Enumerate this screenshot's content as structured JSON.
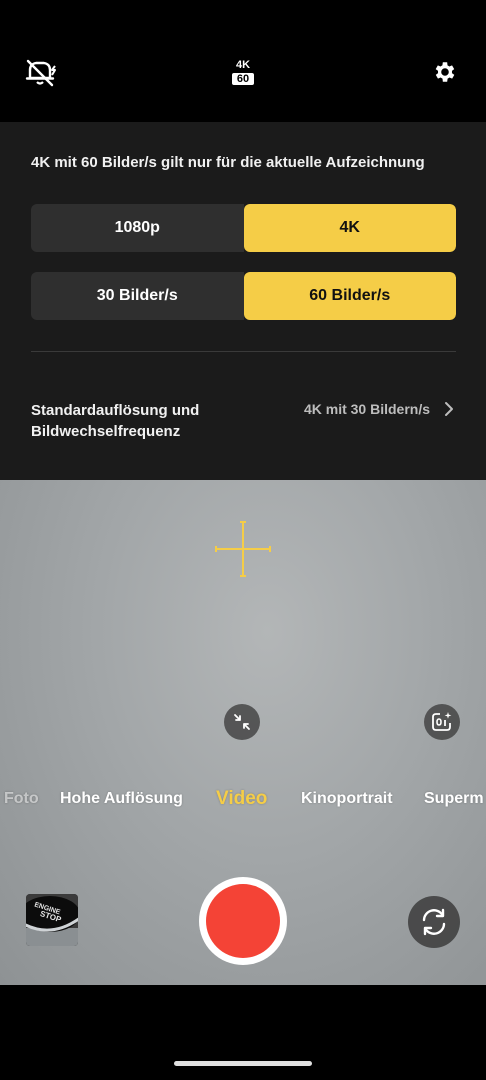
{
  "top_bar": {
    "flash_icon": "flash-off-icon",
    "resolution_badge": {
      "top": "4K",
      "bottom": "60"
    },
    "settings_icon": "gear-icon"
  },
  "panel": {
    "note": "4K mit 60 Bilder/s gilt nur für die aktuelle Aufzeichnung",
    "resolution_options": [
      "1080p",
      "4K"
    ],
    "selected_resolution": "4K",
    "framerate_options": [
      "30 Bilder/s",
      "60 Bilder/s"
    ],
    "selected_framerate": "60 Bilder/s",
    "default_label": "Standardauflösung und Bildwechselfrequenz",
    "default_value": "4K mit 30 Bildern/s"
  },
  "modes": {
    "items": [
      "Foto",
      "Hohe Auflösung",
      "Video",
      "Kinoportrait",
      "Superm"
    ],
    "active": "Video"
  },
  "thumbnail_text": [
    "ENGINE",
    "STOP"
  ],
  "colors": {
    "accent": "#f5cd47",
    "record": "#f44336",
    "panel_bg": "#1b1b1b"
  }
}
